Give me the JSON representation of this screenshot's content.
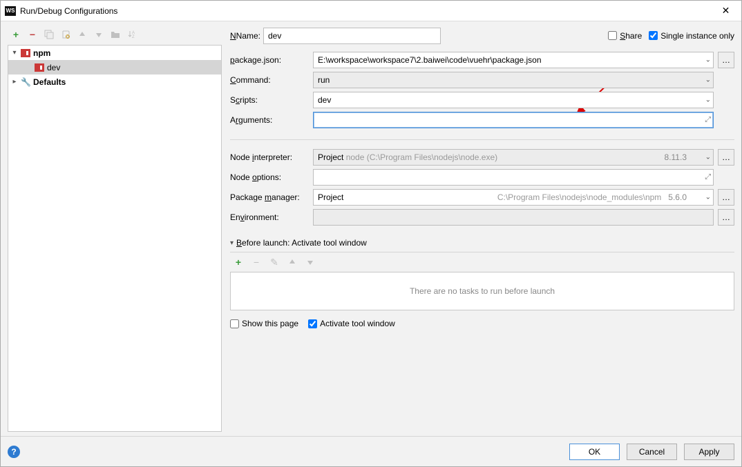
{
  "title": "Run/Debug Configurations",
  "toolbar": {
    "add": "+",
    "remove": "−"
  },
  "tree": {
    "npm_label": "npm",
    "dev_label": "dev",
    "defaults_label": "Defaults"
  },
  "form": {
    "name_label": "Name:",
    "name_value": "dev",
    "share_label": "Share",
    "single_instance_label": "Single instance only",
    "package_json_label": "package.json:",
    "package_json_value": "E:\\workspace\\workspace7\\2.baiwei\\code\\vuehr\\package.json",
    "command_label": "Command:",
    "command_value": "run",
    "scripts_label": "Scripts:",
    "scripts_value": "dev",
    "arguments_label": "Arguments:",
    "arguments_value": "",
    "node_interp_label": "Node interpreter:",
    "node_interp_prefix": "Project",
    "node_interp_path": "node (C:\\Program Files\\nodejs\\node.exe)",
    "node_interp_version": "8.11.3",
    "node_options_label": "Node options:",
    "node_options_value": "",
    "pkg_manager_label": "Package manager:",
    "pkg_manager_prefix": "Project",
    "pkg_manager_path": "C:\\Program Files\\nodejs\\node_modules\\npm",
    "pkg_manager_version": "5.6.0",
    "environment_label": "Environment:",
    "environment_value": ""
  },
  "before_launch": {
    "header": "Before launch: Activate tool window",
    "empty_text": "There are no tasks to run before launch",
    "show_page_label": "Show this page",
    "activate_label": "Activate tool window"
  },
  "buttons": {
    "ok": "OK",
    "cancel": "Cancel",
    "apply": "Apply"
  },
  "more": "…"
}
